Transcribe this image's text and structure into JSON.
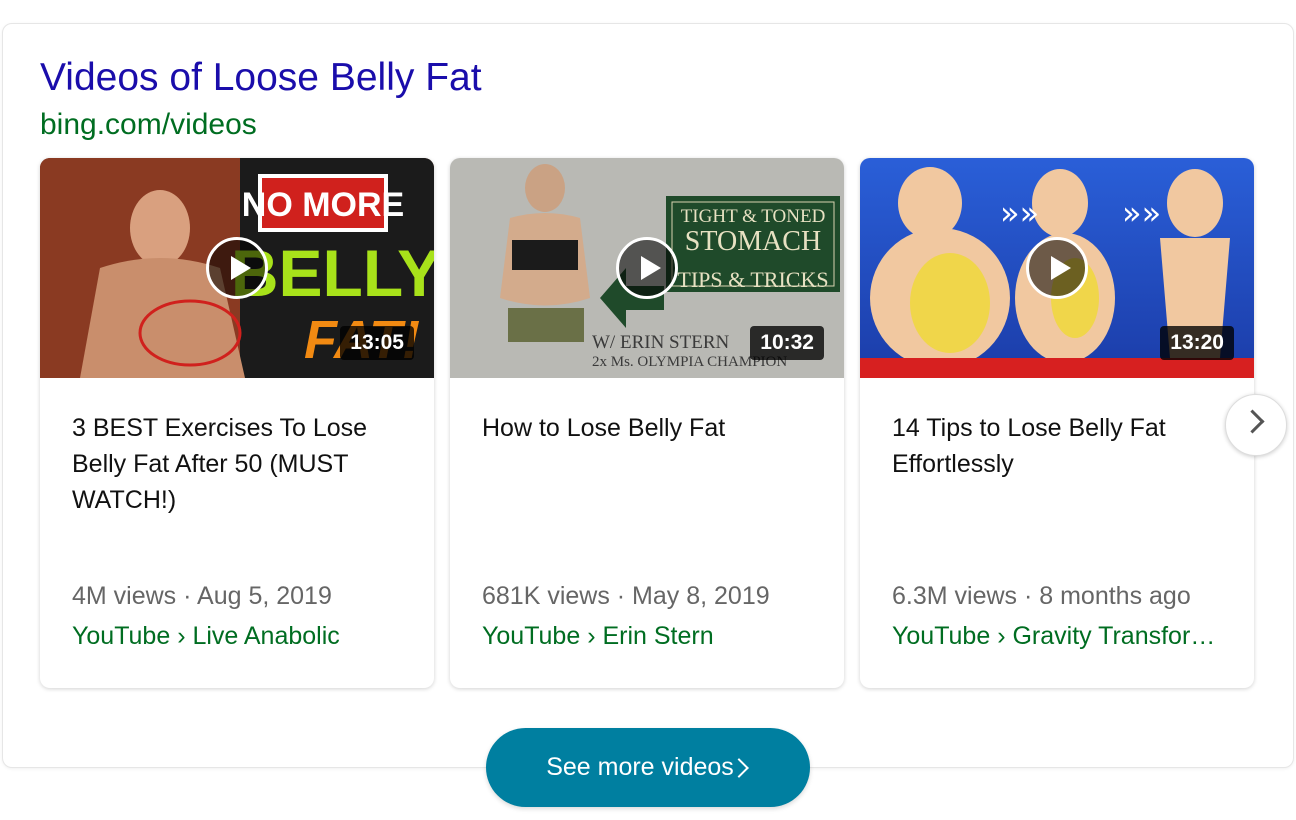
{
  "header": {
    "title": "Videos of Loose Belly Fat",
    "source": "bing.com/videos"
  },
  "videos": [
    {
      "duration": "13:05",
      "title": "3 BEST Exercises To Lose Belly Fat After 50 (MUST WATCH!)",
      "meta": "4M views · Aug 5, 2019",
      "channel": "YouTube › Live Anabolic",
      "thumb_text": [
        "NO MORE",
        "BELLY",
        "FAT!"
      ]
    },
    {
      "duration": "10:32",
      "title": "How to Lose Belly Fat",
      "meta": "681K views · May 8, 2019",
      "channel": "YouTube › Erin Stern",
      "thumb_text": [
        "TIGHT & TONED",
        "STOMACH",
        "TIPS & TRICKS",
        "W/ ERIN STERN",
        "2x Ms. OLYMPIA CHAMPION"
      ]
    },
    {
      "duration": "13:20",
      "title": "14 Tips to Lose Belly Fat Effortlessly",
      "meta": "6.3M views · 8 months ago",
      "channel": "YouTube › Gravity Transfor…"
    }
  ],
  "buttons": {
    "see_more": "See more videos"
  },
  "colors": {
    "title": "#1a0dab",
    "source": "#006d21",
    "button": "#007fa0"
  },
  "icons": {
    "play": "play-icon",
    "next": "chevron-right-icon"
  }
}
